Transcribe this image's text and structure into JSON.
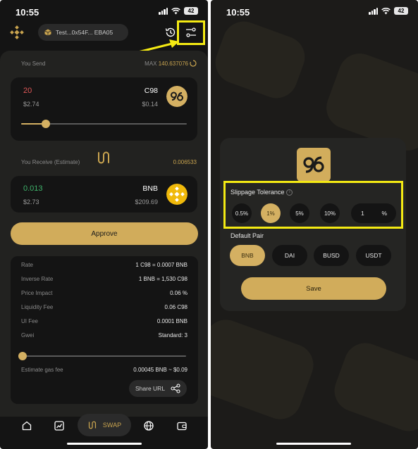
{
  "status_bar": {
    "time": "10:55",
    "battery": "42"
  },
  "swap": {
    "wallet_label": "Test...0x54F... EBA05",
    "you_send_label": "You Send",
    "max_label": "MAX",
    "max_value": "140.637076",
    "send": {
      "amount": "20",
      "usd": "$2.74",
      "token": "C98",
      "token_usd": "$0.14",
      "slider_fraction": 0.15
    },
    "receive_label": "You Receive (Estimate)",
    "receive_value": "0.006533",
    "receive": {
      "amount": "0.013",
      "usd": "$2.73",
      "token": "BNB",
      "token_usd": "$209.69"
    },
    "approve_label": "Approve",
    "details": [
      {
        "key": "Rate",
        "value": "1 C98 = 0.0007 BNB"
      },
      {
        "key": "Inverse Rate",
        "value": "1 BNB = 1,530 C98"
      },
      {
        "key": "Price Impact",
        "value": "0.06 %"
      },
      {
        "key": "Liquidity Fee",
        "value": "0.06 C98"
      },
      {
        "key": "UI Fee",
        "value": "0.0001 BNB"
      },
      {
        "key": "Gwei",
        "value": "Standard: 3"
      }
    ],
    "gas_slider_fraction": 0.0,
    "gas_fee_label": "Estimate gas fee",
    "gas_fee_value": "0.00045 BNB ~ $0.09",
    "share_label": "Share URL"
  },
  "nav": {
    "swap_label": "SWAP"
  },
  "settings": {
    "slippage_title": "Slippage Tolerance",
    "info_glyph": "i",
    "slippage_options": [
      "0.5%",
      "1%",
      "5%",
      "10%"
    ],
    "selected_slippage": "1%",
    "custom_value": "1",
    "custom_unit": "%",
    "default_pair_title": "Default Pair",
    "pairs": [
      "BNB",
      "DAI",
      "BUSD",
      "USDT"
    ],
    "selected_pair": "BNB",
    "save_label": "Save"
  },
  "colors": {
    "accent": "#d1ac5b",
    "highlight": "#f4ea13",
    "negative": "#e05858",
    "positive": "#3fb36b"
  },
  "icons": [
    "bnb-logo-icon",
    "history-icon",
    "settings-sliders-icon",
    "swap-arrows-icon",
    "c98-token-icon",
    "bnb-token-icon",
    "share-icon",
    "home-icon",
    "chart-icon",
    "globe-icon",
    "wallet-icon",
    "info-icon"
  ]
}
